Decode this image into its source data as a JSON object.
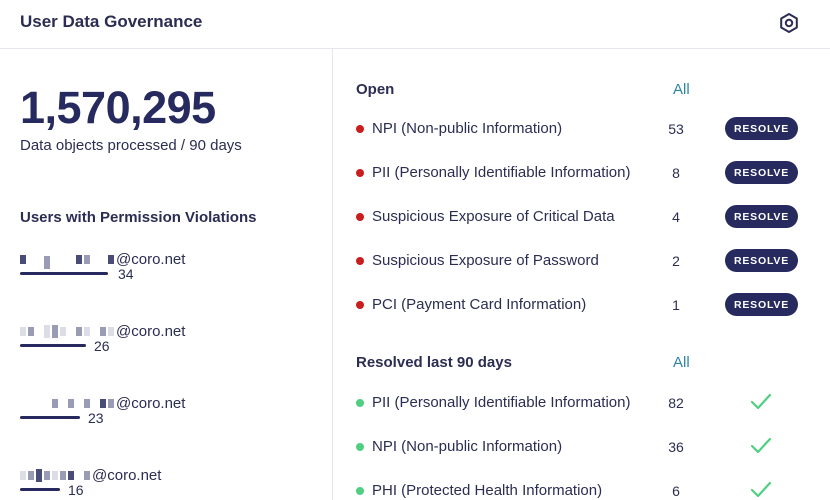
{
  "header": {
    "title": "User Data Governance",
    "settings_icon": "gear-hex-icon"
  },
  "stats": {
    "processed": "1,570,295",
    "processed_caption": "Data objects processed / 90 days"
  },
  "violations": {
    "title": "Users with Permission Violations",
    "users": [
      {
        "email": "@coro.net",
        "count": "34",
        "bar_fraction": 0.88
      },
      {
        "email": "@coro.net",
        "count": "26",
        "bar_fraction": 0.67
      },
      {
        "email": "@coro.net",
        "count": "23",
        "bar_fraction": 0.59
      },
      {
        "email": "@coro.net",
        "count": "16",
        "bar_fraction": 0.4
      }
    ]
  },
  "open": {
    "title": "Open",
    "all_label": "All",
    "resolve_label": "RESOLVE",
    "status_color": "#c81e1e",
    "items": [
      {
        "label": "NPI (Non-public Information)",
        "count": "53"
      },
      {
        "label": "PII (Personally Identifiable Information)",
        "count": "8"
      },
      {
        "label": "Suspicious Exposure of Critical Data",
        "count": "4"
      },
      {
        "label": "Suspicious Exposure of Password",
        "count": "2"
      },
      {
        "label": "PCI (Payment Card Information)",
        "count": "1"
      }
    ]
  },
  "resolved": {
    "title": "Resolved last 90 days",
    "all_label": "All",
    "status_color": "#4fcf82",
    "check_icon": "check-icon",
    "items": [
      {
        "label": "PII (Personally Identifiable Information)",
        "count": "82"
      },
      {
        "label": "NPI (Non-public Information)",
        "count": "36"
      },
      {
        "label": "PHI (Protected Health Information)",
        "count": "6"
      }
    ]
  }
}
